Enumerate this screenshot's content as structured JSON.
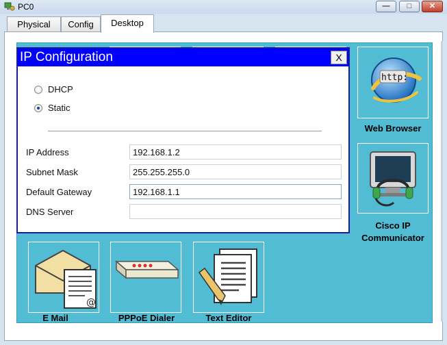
{
  "window": {
    "title": "PC0"
  },
  "tabs": [
    {
      "label": "Physical"
    },
    {
      "label": "Config"
    },
    {
      "label": "Desktop"
    }
  ],
  "apps": {
    "web_browser": {
      "label": "Web Browser",
      "badge": "http:"
    },
    "cisco_ip_communicator": {
      "label_line1": "Cisco IP",
      "label_line2": "Communicator"
    },
    "email": {
      "label": "E Mail"
    },
    "pppoe_dialer": {
      "label": "PPPoE Dialer"
    },
    "text_editor": {
      "label": "Text Editor"
    }
  },
  "ip_config": {
    "title": "IP Configuration",
    "close_label": "X",
    "mode_options": [
      {
        "label": "DHCP",
        "selected": false
      },
      {
        "label": "Static",
        "selected": true
      }
    ],
    "fields": {
      "ip_address": {
        "label": "IP Address",
        "value": "192.168.1.2"
      },
      "subnet_mask": {
        "label": "Subnet Mask",
        "value": "255.255.255.0"
      },
      "default_gateway": {
        "label": "Default Gateway",
        "value": "192.168.1.1"
      },
      "dns_server": {
        "label": "DNS Server",
        "value": ""
      }
    }
  },
  "colors": {
    "desktop_background": "#52bcd4",
    "dialog_header": "#0000ff"
  }
}
